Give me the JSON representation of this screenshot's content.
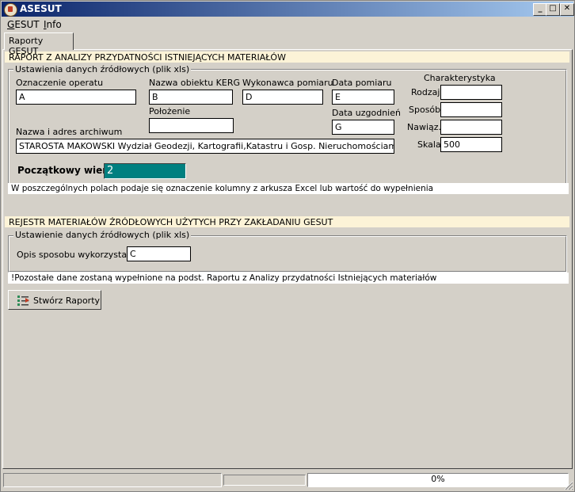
{
  "window": {
    "title": "ASESUT",
    "minimize": "_",
    "maximize": "□",
    "close": "✕"
  },
  "menu": [
    {
      "accel": "G",
      "rest": "ESUT"
    },
    {
      "accel": "I",
      "rest": "nfo"
    }
  ],
  "tab": {
    "label": "Raporty GESUT"
  },
  "report1": {
    "header": "RAPORT Z ANALIZY PRZYDATNOŚCI ISTNIEJĄCYCH MATERIAŁÓW",
    "group_label": "Ustawienia danych źródłowych (plik xls)",
    "fields": {
      "oznaczenie": {
        "label": "Oznaczenie operatu",
        "value": "A"
      },
      "nazwa_obiektu": {
        "label": "Nazwa obiektu KERG",
        "value": "B"
      },
      "wykonawca": {
        "label": "Wykonawca pomiaru",
        "value": "D"
      },
      "data_pomiaru": {
        "label": "Data pomiaru",
        "value": "E"
      },
      "polozenie": {
        "label": "Położenie",
        "value": ""
      },
      "data_uzgodnien": {
        "label": "Data uzgodnień",
        "value": "G"
      },
      "nazwa_archiwum": {
        "label": "Nazwa i adres archiwum",
        "value": "STAROSTA MAKOWSKI  Wydział Geodezji, Kartografii,Katastru i Gosp. Nieruchomościami"
      }
    },
    "charakterystyka": {
      "title": "Charakterystyka",
      "rodzaj": {
        "label": "Rodzaj",
        "value": ""
      },
      "sposob": {
        "label": "Sposób",
        "value": ""
      },
      "nawiaz": {
        "label": "Nawiąz.",
        "value": ""
      },
      "skala": {
        "label": "Skala",
        "value": "500"
      }
    },
    "start_row": {
      "label": "Początkowy wiersz",
      "value": "2"
    },
    "note": "W poszczególnych polach podaje się  oznaczenie kolumny z arkusza Excel lub wartość do wypełnienia"
  },
  "report2": {
    "header": "REJESTR MATERIAŁÓW ŹRÓDŁOWYCH UŻYTYCH PRZY ZAKŁADANIU GESUT",
    "group_label": "Ustawienie danych źródłowych (plik xls)",
    "opis": {
      "label": "Opis sposobu wykorzystania",
      "value": "C"
    },
    "note": "!Pozostałe dane zostaną wypełnione na podst. Raportu z Analizy przydatności Istniejących materiałów"
  },
  "create_button": {
    "label": "Stwórz Raporty"
  },
  "status": {
    "progress_text": "0%",
    "progress": 0
  }
}
